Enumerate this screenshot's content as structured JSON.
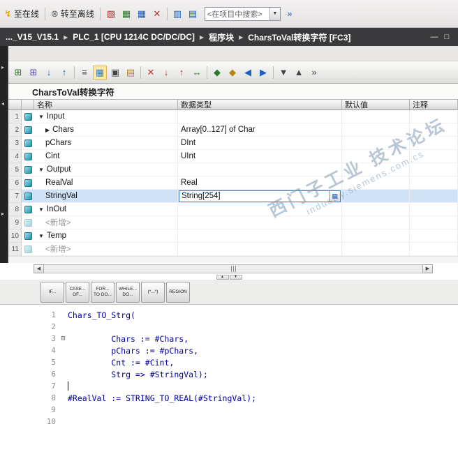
{
  "colors": {
    "accent_blue": "#2f7ed1",
    "selection_bg": "#cfe2f6",
    "breadcrumb_bg": "#3a3a3c",
    "code_text": "#0000a0"
  },
  "top_toolbar": {
    "go_online_label": "至在线",
    "go_offline_label": "转至离线",
    "search_value": "<在项目中搜索>",
    "search_dropdown_glyph": "▼",
    "go_online_glyph": "↯",
    "go_offline_glyph": "⊗",
    "icons": [
      {
        "name": "diagnostics-icon",
        "glyph": "▧",
        "color": "#b03030"
      },
      {
        "name": "start-simulation-icon",
        "glyph": "▦",
        "color": "#2c7a2c"
      },
      {
        "name": "stop-simulation-icon",
        "glyph": "▦",
        "color": "#1f5fbf"
      },
      {
        "name": "cancel-icon",
        "glyph": "✕",
        "color": "#b03030"
      },
      {
        "sep": true
      },
      {
        "name": "split-editor-horizontal-icon",
        "glyph": "▥",
        "color": "#1f5fbf"
      },
      {
        "name": "split-editor-vertical-icon",
        "glyph": "▤",
        "color": "#1f5fbf"
      }
    ],
    "after_search_icons": [
      {
        "name": "search-next-icon",
        "glyph": "»",
        "color": "#1f5fbf"
      }
    ]
  },
  "breadcrumb": {
    "items": [
      "..._V15_V15.1",
      "PLC_1 [CPU 1214C DC/DC/DC]",
      "程序块",
      "CharsToVal转换字符 [FC3]"
    ],
    "window_buttons": [
      {
        "name": "minimize-window-icon",
        "glyph": "—"
      },
      {
        "name": "maximize-window-icon",
        "glyph": "□"
      }
    ]
  },
  "left_strip": {
    "icons": [
      {
        "name": "collapsed-pane-handle-top-icon",
        "glyph": "▸"
      },
      {
        "name": "collapsed-pane-handle-mid-icon",
        "glyph": "◂"
      },
      {
        "name": "collapsed-pane-handle-bottom-icon",
        "glyph": "▸"
      }
    ]
  },
  "editor_toolbar": {
    "icons": [
      {
        "name": "add-row-icon",
        "glyph": "⊞",
        "color": "#2c7a2c"
      },
      {
        "name": "insert-row-icon",
        "glyph": "⊞",
        "color": "#4a4ad0"
      },
      {
        "name": "download-start-values-icon",
        "glyph": "↓",
        "color": "#1f5fbf"
      },
      {
        "name": "upload-start-values-icon",
        "glyph": "↑",
        "color": "#1f5fbf"
      },
      {
        "sep": true
      },
      {
        "name": "sort-icon",
        "glyph": "≡",
        "color": "#444444"
      },
      {
        "name": "expand-all-icon",
        "glyph": "▦",
        "color": "#2f7ed1",
        "active": true
      },
      {
        "name": "snapshot-icon",
        "glyph": "▣",
        "color": "#444444"
      },
      {
        "name": "favorites-icon",
        "glyph": "▤",
        "color": "#b8860b"
      },
      {
        "sep": true
      },
      {
        "name": "reset-values-icon",
        "glyph": "✕",
        "color": "#c0392b"
      },
      {
        "name": "download-to-device-icon",
        "glyph": "↓",
        "color": "#c0392b"
      },
      {
        "name": "upload-from-device-icon",
        "glyph": "↑",
        "color": "#c0392b"
      },
      {
        "name": "synchronize-icon",
        "glyph": "↔",
        "color": "#2c7a2c"
      },
      {
        "sep": true
      },
      {
        "name": "monitor-icon",
        "glyph": "◆",
        "color": "#2c7a2c"
      },
      {
        "name": "modify-icon",
        "glyph": "◆",
        "color": "#b8860b"
      },
      {
        "name": "goto-previous-icon",
        "glyph": "◀",
        "color": "#1f5fbf"
      },
      {
        "name": "goto-next-icon",
        "glyph": "▶",
        "color": "#1f5fbf"
      },
      {
        "sep": true
      },
      {
        "name": "expand-networks-icon",
        "glyph": "▼",
        "color": "#444444"
      },
      {
        "name": "collapse-networks-icon",
        "glyph": "▲",
        "color": "#444444"
      },
      {
        "name": "more-tools-icon",
        "glyph": "»",
        "color": "#444444"
      }
    ]
  },
  "block": {
    "title": "CharsToVal转换字符"
  },
  "table": {
    "headers": {
      "name": "名称",
      "type": "数据类型",
      "default": "默认值",
      "comment": "注释"
    },
    "browse_button_glyph": "▦",
    "rows": [
      {
        "num": "1",
        "expander": "▼",
        "name": "Input",
        "type": "",
        "level": 0
      },
      {
        "num": "2",
        "expander": "▶",
        "name": "Chars",
        "type": "Array[0..127] of Char",
        "level": 1
      },
      {
        "num": "3",
        "name": "pChars",
        "type": "DInt",
        "level": 1
      },
      {
        "num": "4",
        "name": "Cint",
        "type": "UInt",
        "level": 1
      },
      {
        "num": "5",
        "expander": "▼",
        "name": "Output",
        "type": "",
        "level": 0
      },
      {
        "num": "6",
        "name": "RealVal",
        "type": "Real",
        "level": 1
      },
      {
        "num": "7",
        "name": "StringVal",
        "type": "String[254]",
        "level": 1,
        "selected": true
      },
      {
        "num": "8",
        "expander": "▼",
        "name": "InOut",
        "type": "",
        "level": 0
      },
      {
        "num": "9",
        "name": "<新增>",
        "type": "",
        "level": 1,
        "placeholder": true
      },
      {
        "num": "10",
        "expander": "▼",
        "name": "Temp",
        "type": "",
        "level": 0
      },
      {
        "num": "11",
        "name": "<新增>",
        "type": "",
        "level": 1,
        "placeholder": true
      }
    ]
  },
  "scrollbar": {
    "left_arrow": "◀",
    "right_arrow": "▶",
    "splitter_up": "▲",
    "splitter_down": "▼"
  },
  "snippet_tabs": [
    [
      "IF...",
      ""
    ],
    [
      "CASE...",
      "OF..."
    ],
    [
      "FOR...",
      "TO DO..."
    ],
    [
      "WHILE...",
      "DO..."
    ],
    [
      "(*...*)",
      ""
    ],
    [
      "REGION",
      ""
    ]
  ],
  "code": {
    "fold_glyph": "⊟",
    "lines": [
      {
        "n": "1",
        "t": "Chars_TO_Strg("
      },
      {
        "n": "2",
        "t": ""
      },
      {
        "n": "3",
        "t": "         Chars := #Chars,",
        "fold": true
      },
      {
        "n": "4",
        "t": "         pChars := #pChars,"
      },
      {
        "n": "5",
        "t": "         Cnt := #Cint,"
      },
      {
        "n": "6",
        "t": "         Strg => #StringVal);"
      },
      {
        "n": "7",
        "t": "",
        "caret": true
      },
      {
        "n": "8",
        "t": "#RealVal := STRING_TO_REAL(#StringVal);"
      },
      {
        "n": "9",
        "t": ""
      },
      {
        "n": "10",
        "t": ""
      }
    ]
  },
  "watermark": {
    "line1": "西门子工业 技术论坛",
    "line2": "industry.siemens.com.cs"
  }
}
